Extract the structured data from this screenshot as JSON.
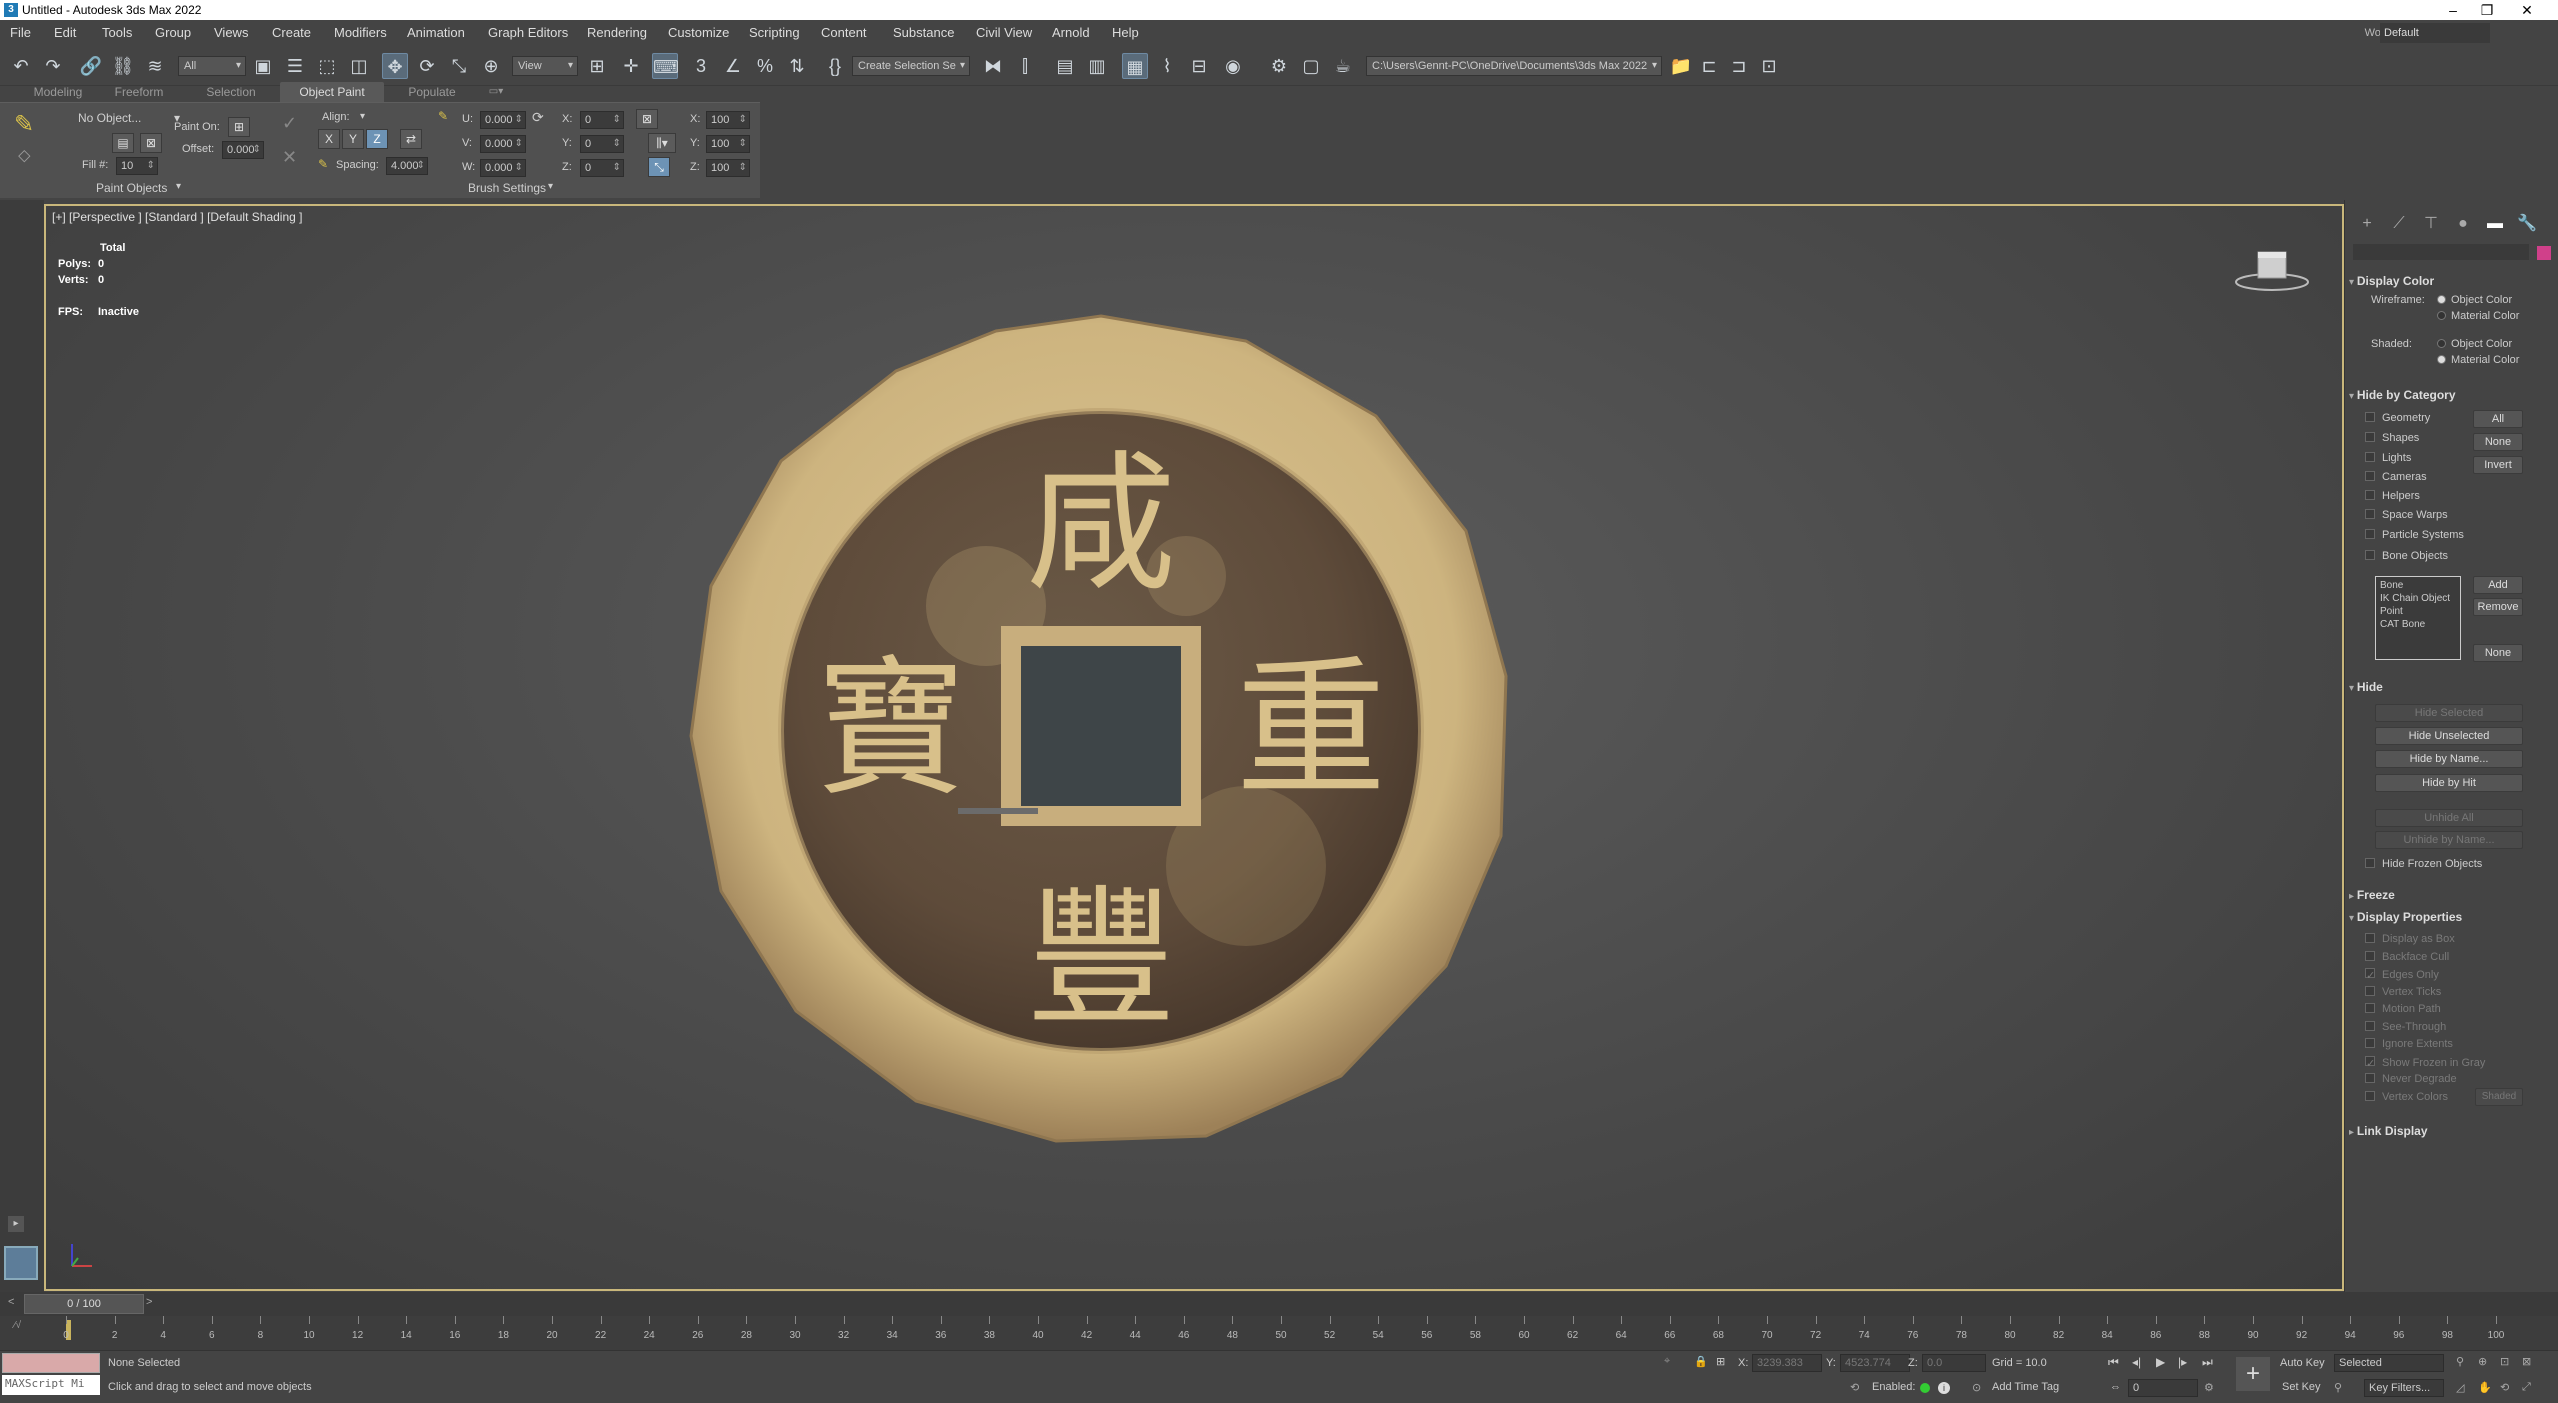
{
  "app": {
    "title": "Untitled - Autodesk 3ds Max 2022",
    "workspaces_label": "Workspaces:",
    "workspace": "Default"
  },
  "menu": [
    "File",
    "Edit",
    "Tools",
    "Group",
    "Views",
    "Create",
    "Modifiers",
    "Animation",
    "Graph Editors",
    "Rendering",
    "Customize",
    "Scripting",
    "Content",
    "Substance",
    "Civil View",
    "Arnold",
    "Help"
  ],
  "toolbar": {
    "selection_filter": "All",
    "ref_coord": "View",
    "selection_set": "Create Selection Se",
    "project_path": "C:\\Users\\Gennt-PC\\OneDrive\\Documents\\3ds Max 2022"
  },
  "ribbon": {
    "tabs": [
      "Modeling",
      "Freeform",
      "Selection",
      "Object Paint",
      "Populate"
    ],
    "active_tab": "Object Paint",
    "no_object": "No Object...",
    "paint_on_label": "Paint On:",
    "offset_label": "Offset:",
    "offset_value": "0.000",
    "fill_label": "Fill #:",
    "fill_value": "10",
    "align_label": "Align:",
    "axis_x": "X",
    "axis_y": "Y",
    "axis_z": "Z",
    "spacing_label": "Spacing:",
    "spacing_value": "4.000",
    "u_label": "U:",
    "v_label": "V:",
    "w_label": "W:",
    "u_value": "0.000",
    "v_value": "0.000",
    "w_value": "0.000",
    "rx_label": "X:",
    "ry_label": "Y:",
    "rz_label": "Z:",
    "rx_value": "0",
    "ry_value": "0",
    "rz_value": "0",
    "sx_label": "X:",
    "sy_label": "Y:",
    "sz_label": "Z:",
    "sx_value": "100",
    "sy_value": "100",
    "sz_value": "100",
    "paint_objects": "Paint Objects",
    "brush_settings": "Brush Settings"
  },
  "viewport": {
    "label": "[+] [Perspective ] [Standard ] [Default Shading ]",
    "total_label": "Total",
    "polys_label": "Polys:",
    "polys_value": "0",
    "verts_label": "Verts:",
    "verts_value": "0",
    "fps_label": "FPS:",
    "fps_value": "Inactive",
    "coin_chars": [
      "咸",
      "重",
      "豐",
      "寶"
    ]
  },
  "command_panel": {
    "display_color": "Display Color",
    "wireframe_label": "Wireframe:",
    "shaded_label": "Shaded:",
    "object_color": "Object Color",
    "material_color": "Material Color",
    "hide_by_category": "Hide by Category",
    "categories": [
      "Geometry",
      "Shapes",
      "Lights",
      "Cameras",
      "Helpers",
      "Space Warps",
      "Particle Systems",
      "Bone Objects"
    ],
    "btn_all": "All",
    "btn_none": "None",
    "btn_invert": "Invert",
    "list_items": [
      "Bone",
      "IK Chain Object",
      "Point",
      "CAT Bone"
    ],
    "btn_add": "Add",
    "btn_remove": "Remove",
    "btn_none2": "None",
    "hide": "Hide",
    "hide_selected": "Hide Selected",
    "hide_unselected": "Hide Unselected",
    "hide_by_name": "Hide by Name...",
    "hide_by_hit": "Hide by Hit",
    "unhide_all": "Unhide All",
    "unhide_by_name": "Unhide by Name...",
    "hide_frozen": "Hide Frozen Objects",
    "freeze": "Freeze",
    "display_properties": "Display Properties",
    "props": [
      "Display as Box",
      "Backface Cull",
      "Edges Only",
      "Vertex Ticks",
      "Motion Path",
      "See-Through",
      "Ignore Extents",
      "Show Frozen in Gray",
      "Never Degrade",
      "Vertex Colors"
    ],
    "shaded_btn": "Shaded",
    "link_display": "Link Display"
  },
  "timeline": {
    "frame": "0 / 100",
    "ticks": [
      0,
      2,
      4,
      6,
      8,
      10,
      12,
      14,
      16,
      18,
      20,
      22,
      24,
      26,
      28,
      30,
      32,
      34,
      36,
      38,
      40,
      42,
      44,
      46,
      48,
      50,
      52,
      54,
      56,
      58,
      60,
      62,
      64,
      66,
      68,
      70,
      72,
      74,
      76,
      78,
      80,
      82,
      84,
      86,
      88,
      90,
      92,
      94,
      96,
      98,
      100
    ]
  },
  "status": {
    "maxscript": "MAXScript Mi",
    "selected": "None Selected",
    "prompt": "Click and drag to select and move objects",
    "x_label": "X:",
    "x_value": "3239.383",
    "y_label": "Y:",
    "y_value": "4523.774",
    "z_label": "Z:",
    "z_value": "0.0",
    "grid": "Grid = 10.0",
    "enabled_label": "Enabled:",
    "add_time_tag": "Add Time Tag",
    "auto_key": "Auto Key",
    "set_key": "Set Key",
    "selected_dd": "Selected",
    "key_filters": "Key Filters...",
    "frame_value": "0"
  }
}
